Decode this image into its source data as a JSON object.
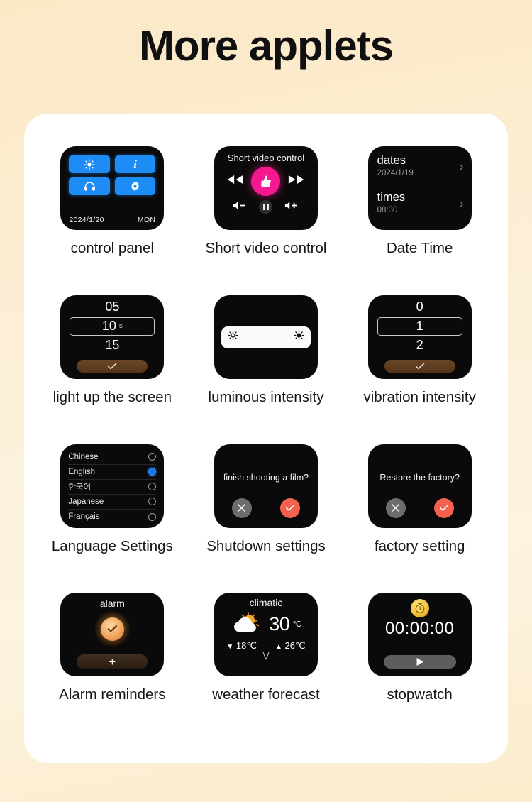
{
  "page": {
    "title": "More applets"
  },
  "tiles": [
    {
      "caption": "control panel",
      "buttons": [
        "brightness-icon",
        "info-icon",
        "headphones-icon",
        "gear-icon"
      ],
      "date": "2024/1/20",
      "weekday": "MON"
    },
    {
      "caption": "Short video control",
      "screen_title": "Short video control",
      "controls": [
        "rewind-icon",
        "like-icon",
        "forward-icon",
        "volume-down-icon",
        "pause-icon",
        "volume-up-icon"
      ]
    },
    {
      "caption": "Date Time",
      "rows": [
        {
          "label": "dates",
          "value": "2024/1/19",
          "chevron": "›"
        },
        {
          "label": "times",
          "value": "08:30",
          "chevron": "›"
        }
      ]
    },
    {
      "caption": "light up the screen",
      "above": "05",
      "selected": "10",
      "unit": "s",
      "below": "15",
      "confirm": "check-icon"
    },
    {
      "caption": "luminous intensity",
      "left_icon": "brightness-low-icon",
      "right_icon": "brightness-high-icon"
    },
    {
      "caption": "vibration intensity",
      "above": "0",
      "selected": "1",
      "unit": "",
      "below": "2",
      "confirm": "check-icon"
    },
    {
      "caption": "Language Settings",
      "languages": [
        {
          "name": "Chinese",
          "selected": false
        },
        {
          "name": "English",
          "selected": true
        },
        {
          "name": "한국어",
          "selected": false
        },
        {
          "name": "Japanese",
          "selected": false
        },
        {
          "name": "Français",
          "selected": false
        }
      ]
    },
    {
      "caption": "Shutdown settings",
      "question": "finish shooting a film?",
      "cancel": "close-icon",
      "confirm": "check-icon"
    },
    {
      "caption": "factory setting",
      "question": "Restore the factory?",
      "cancel": "close-icon",
      "confirm": "check-icon"
    },
    {
      "caption": "Alarm reminders",
      "screen_title": "alarm",
      "clock": "alarm-clock-icon",
      "add": "+"
    },
    {
      "caption": "weather forecast",
      "screen_title": "climatic",
      "icon": "partly-cloudy-icon",
      "temp": "30",
      "temp_unit": "℃",
      "low": "18℃",
      "high": "26℃",
      "low_arrow": "▼",
      "high_arrow": "▲",
      "more": "⋁"
    },
    {
      "caption": "stopwatch",
      "icon": "stopwatch-icon",
      "time": "00:00:00",
      "play": "play-icon"
    }
  ],
  "colors": {
    "background": "#fbeccd",
    "card": "#ffffff",
    "screen": "#0a0a0a",
    "accent_blue": "#1e8cf5",
    "accent_pink": "#f5188f",
    "accent_red": "#f4624f",
    "accent_orange": "#f0a45c",
    "accent_yellow": "#f2c23c"
  }
}
